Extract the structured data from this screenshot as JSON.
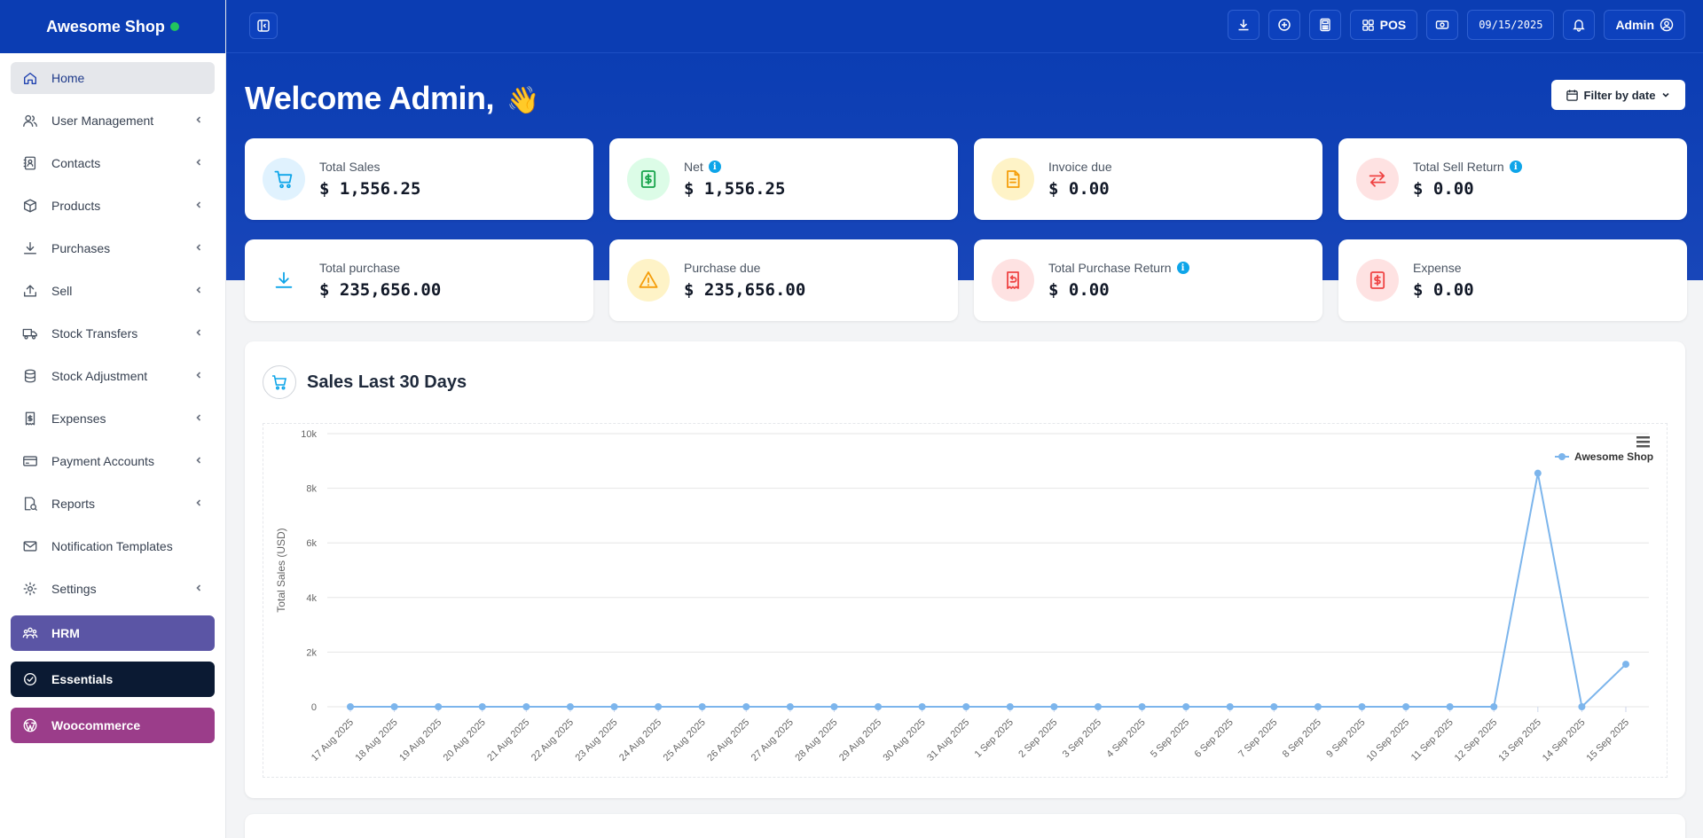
{
  "app": {
    "name": "Awesome Shop",
    "online_color": "#22c55e",
    "primary_color": "#0b3db3"
  },
  "sidebar": {
    "items": [
      {
        "label": "Home",
        "icon": "home-icon",
        "active": true,
        "has_submenu": false
      },
      {
        "label": "User Management",
        "icon": "users-icon",
        "has_submenu": true
      },
      {
        "label": "Contacts",
        "icon": "contacts-icon",
        "has_submenu": true
      },
      {
        "label": "Products",
        "icon": "box-icon",
        "has_submenu": true
      },
      {
        "label": "Purchases",
        "icon": "download-icon",
        "has_submenu": true
      },
      {
        "label": "Sell",
        "icon": "upload-icon",
        "has_submenu": true
      },
      {
        "label": "Stock Transfers",
        "icon": "truck-icon",
        "has_submenu": true
      },
      {
        "label": "Stock Adjustment",
        "icon": "database-icon",
        "has_submenu": true
      },
      {
        "label": "Expenses",
        "icon": "receipt-icon",
        "has_submenu": true
      },
      {
        "label": "Payment Accounts",
        "icon": "credit-card-icon",
        "has_submenu": true
      },
      {
        "label": "Reports",
        "icon": "report-icon",
        "has_submenu": true
      },
      {
        "label": "Notification Templates",
        "icon": "mail-icon",
        "has_submenu": false
      },
      {
        "label": "Settings",
        "icon": "gear-icon",
        "has_submenu": true
      }
    ],
    "modules": [
      {
        "label": "HRM",
        "icon": "team-icon",
        "color": "#5b55a5"
      },
      {
        "label": "Essentials",
        "icon": "check-circle-icon",
        "color": "#0b1a33"
      },
      {
        "label": "Woocommerce",
        "icon": "wordpress-icon",
        "color": "#9b3d8a"
      }
    ]
  },
  "topbar": {
    "pos_label": "POS",
    "date": "09/15/2025",
    "user_label": "Admin"
  },
  "hero": {
    "welcome": "Welcome Admin,",
    "wave": "👋",
    "filter_label": "Filter by date"
  },
  "stats": [
    {
      "label": "Total Sales",
      "value": "$ 1,556.25",
      "info": false,
      "icon": "cart-icon",
      "icon_color": "#0ea5e9",
      "bg": "#e0f2fe"
    },
    {
      "label": "Net",
      "value": "$ 1,556.25",
      "info": true,
      "icon": "money-icon",
      "icon_color": "#16a34a",
      "bg": "#dcfce7"
    },
    {
      "label": "Invoice due",
      "value": "$ 0.00",
      "info": false,
      "icon": "file-icon",
      "icon_color": "#f59e0b",
      "bg": "#fef3c7"
    },
    {
      "label": "Total Sell Return",
      "value": "$ 0.00",
      "info": true,
      "icon": "exchange-icon",
      "icon_color": "#ef4444",
      "bg": "#fee2e2"
    },
    {
      "label": "Total purchase",
      "value": "$ 235,656.00",
      "info": false,
      "icon": "download-icon",
      "icon_color": "#0ea5e9",
      "bg": "#ffffff"
    },
    {
      "label": "Purchase due",
      "value": "$ 235,656.00",
      "info": false,
      "icon": "warning-icon",
      "icon_color": "#f59e0b",
      "bg": "#fef3c7"
    },
    {
      "label": "Total Purchase Return",
      "value": "$ 0.00",
      "info": true,
      "icon": "receipt-return-icon",
      "icon_color": "#ef4444",
      "bg": "#fee2e2"
    },
    {
      "label": "Expense",
      "value": "$ 0.00",
      "info": false,
      "icon": "money-red-icon",
      "icon_color": "#ef4444",
      "bg": "#fee2e2"
    }
  ],
  "chart_panel": {
    "title": "Sales Last 30 Days"
  },
  "chart_data": {
    "type": "line",
    "xlabel": "",
    "ylabel": "Total Sales (USD)",
    "ylim": [
      0,
      10000
    ],
    "yticks": [
      "0",
      "2k",
      "4k",
      "6k",
      "8k",
      "10k"
    ],
    "grid": true,
    "legend_position": "top-right",
    "categories": [
      "17 Aug 2025",
      "18 Aug 2025",
      "19 Aug 2025",
      "20 Aug 2025",
      "21 Aug 2025",
      "22 Aug 2025",
      "23 Aug 2025",
      "24 Aug 2025",
      "25 Aug 2025",
      "26 Aug 2025",
      "27 Aug 2025",
      "28 Aug 2025",
      "29 Aug 2025",
      "30 Aug 2025",
      "31 Aug 2025",
      "1 Sep 2025",
      "2 Sep 2025",
      "3 Sep 2025",
      "4 Sep 2025",
      "5 Sep 2025",
      "6 Sep 2025",
      "7 Sep 2025",
      "8 Sep 2025",
      "9 Sep 2025",
      "10 Sep 2025",
      "11 Sep 2025",
      "12 Sep 2025",
      "13 Sep 2025",
      "14 Sep 2025",
      "15 Sep 2025"
    ],
    "series": [
      {
        "name": "Awesome Shop",
        "color": "#7cb5ec",
        "values": [
          0,
          0,
          0,
          0,
          0,
          0,
          0,
          0,
          0,
          0,
          0,
          0,
          0,
          0,
          0,
          0,
          0,
          0,
          0,
          0,
          0,
          0,
          0,
          0,
          0,
          0,
          0,
          8550,
          0,
          1556.25
        ]
      }
    ]
  }
}
